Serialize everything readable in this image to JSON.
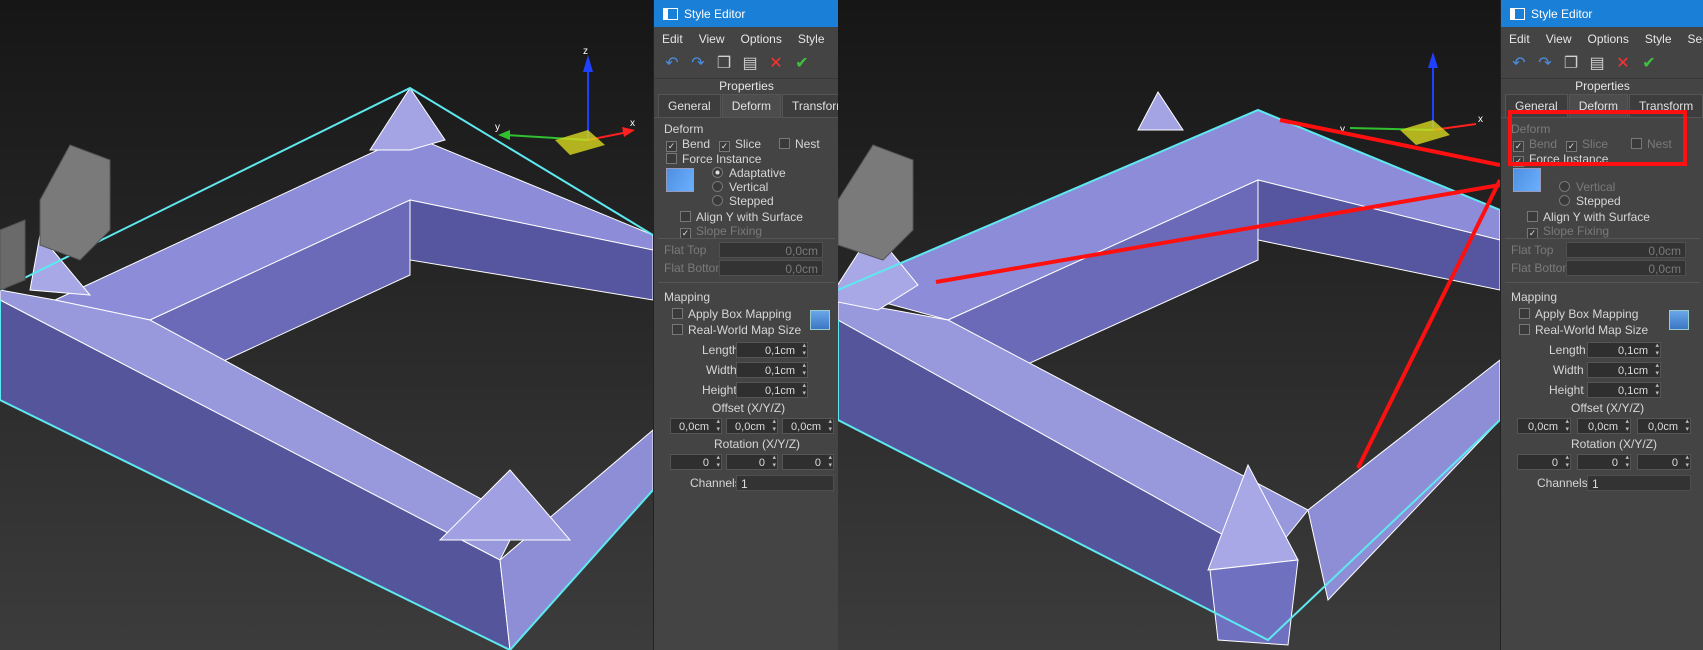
{
  "editor": {
    "title": "Style Editor",
    "menu": [
      "Edit",
      "View",
      "Options",
      "Style",
      "Seg"
    ],
    "toolbar_icons": [
      "undo-icon",
      "redo-icon",
      "copy-icon",
      "paste-icon",
      "delete-icon",
      "apply-icon"
    ],
    "section_title": "Properties",
    "tabs": [
      "General",
      "Deform",
      "Transform"
    ],
    "active_tab": "Deform",
    "deform": {
      "group": "Deform",
      "bend": "Bend",
      "slice": "Slice",
      "nest": "Nest",
      "force_instance": "Force Instance",
      "adaptative": "Adaptative",
      "vertical": "Vertical",
      "stepped": "Stepped",
      "align_y": "Align Y with Surface",
      "slope_fixing": "Slope Fixing",
      "flat_top": "Flat Top",
      "flat_top_value": "0,0cm",
      "flat_bottom": "Flat Bottom",
      "flat_bottom_value": "0,0cm"
    },
    "mapping": {
      "group": "Mapping",
      "apply_box": "Apply Box Mapping",
      "real_world": "Real-World Map Size",
      "length": "Length",
      "length_value": "0,1cm",
      "width": "Width",
      "width_value": "0,1cm",
      "height": "Height",
      "height_value": "0,1cm",
      "offset": "Offset (X/Y/Z)",
      "offset_values": [
        "0,0cm",
        "0,0cm",
        "0,0cm"
      ],
      "rotation": "Rotation (X/Y/Z)",
      "rotation_values": [
        "0",
        "0",
        "0"
      ],
      "channels": "Channels",
      "channels_value": "1"
    }
  },
  "gizmo": {
    "x": "x",
    "y": "y",
    "z": "z"
  },
  "colors": {
    "mesh": "#9090d8",
    "mesh_dark": "#5858a0",
    "outline": "#5ee8f0",
    "highlight": "#ff1010",
    "title_bar": "#1a7fd6"
  }
}
